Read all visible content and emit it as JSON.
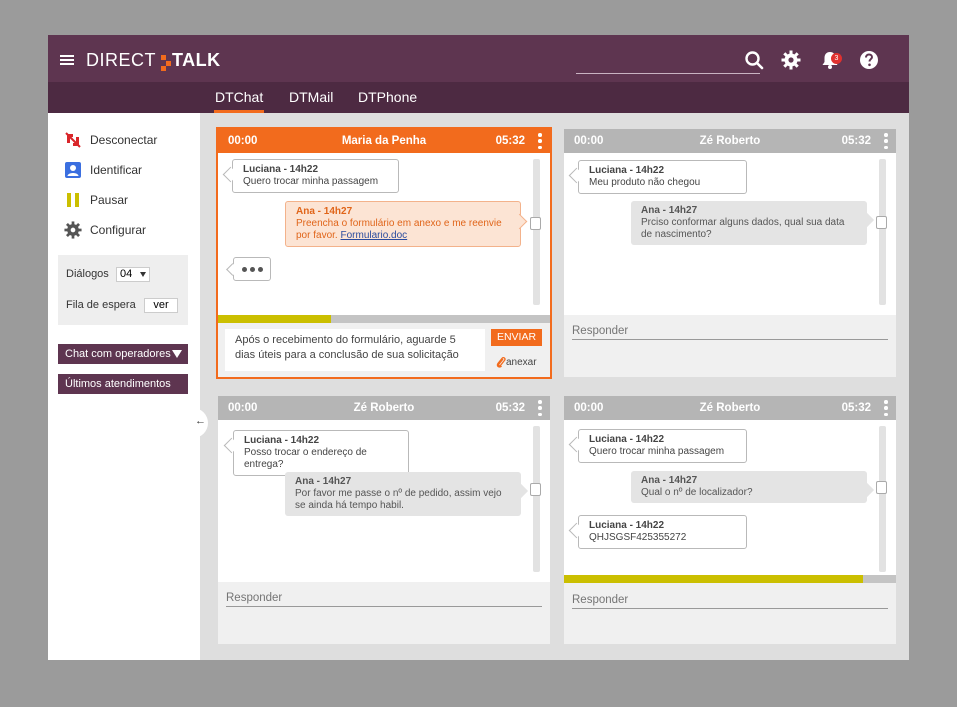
{
  "header": {
    "brand_left": "DIRECT",
    "brand_right": "TALK",
    "notification_count": "3",
    "icons": [
      "menu-icon",
      "search-icon",
      "gear-icon",
      "bell-icon",
      "help-icon"
    ],
    "colors": {
      "primary": "#5e3550",
      "primary_dark": "#4d2a42",
      "accent": "#f26b1d"
    }
  },
  "tabs": [
    {
      "label": "DTChat",
      "active": true
    },
    {
      "label": "DTMail",
      "active": false
    },
    {
      "label": "DTPhone",
      "active": false
    }
  ],
  "sidebar": {
    "items": [
      {
        "label": "Desconectar",
        "icon": "disconnect-icon"
      },
      {
        "label": "Identificar",
        "icon": "identify-icon"
      },
      {
        "label": "Pausar",
        "icon": "pause-icon"
      },
      {
        "label": "Configurar",
        "icon": "gear-icon"
      }
    ],
    "dialogs_label": "Diálogos",
    "dialogs_value": "04",
    "queue_label": "Fila de espera",
    "queue_button": "ver",
    "chat_operators": "Chat com operadores",
    "last_attendances": "Últimos atendimentos"
  },
  "chats": [
    {
      "start": "00:00",
      "name": "Maria da Penha",
      "timer": "05:32",
      "active": true,
      "progress": 0.34,
      "messages": [
        {
          "from": "Luciana - 14h22",
          "text": "Quero trocar minha passagem"
        },
        {
          "from": "Ana - 14h27",
          "text": "Preencha o formulário em anexo e me reenvie por favor.",
          "link": "Formulario.doc"
        }
      ],
      "compose_text": "Após o recebimento do formulário, aguarde 5 dias úteis para a conclusão de sua solicitação",
      "send_label": "ENVIAR",
      "attach_label": "anexar"
    },
    {
      "start": "00:00",
      "name": "Zé Roberto",
      "timer": "05:32",
      "messages": [
        {
          "from": "Luciana - 14h22",
          "text": "Meu produto não chegou"
        },
        {
          "from": "Ana - 14h27",
          "text": "Prciso conformar alguns dados, qual sua data de nascimento?"
        }
      ],
      "reply_placeholder": "Responder"
    },
    {
      "start": "00:00",
      "name": "Zé Roberto",
      "timer": "05:32",
      "messages": [
        {
          "from": "Luciana - 14h22",
          "text": "Posso trocar o endereço de entrega?"
        },
        {
          "from": "Ana - 14h27",
          "text": "Por favor me passe o nº de pedido, assim vejo se ainda há tempo habil."
        }
      ],
      "reply_placeholder": "Responder"
    },
    {
      "start": "00:00",
      "name": "Zé Roberto",
      "timer": "05:32",
      "progress": 0.9,
      "messages": [
        {
          "from": "Luciana - 14h22",
          "text": "Quero trocar minha passagem"
        },
        {
          "from": "Ana - 14h27",
          "text": "Qual o nº de localizador?"
        },
        {
          "from": "Luciana - 14h22",
          "text": "QHJSGSF425355272"
        }
      ],
      "reply_placeholder": "Responder"
    }
  ]
}
